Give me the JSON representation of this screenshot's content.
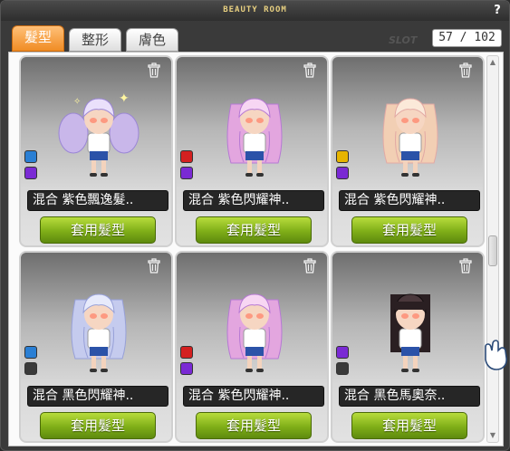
{
  "window": {
    "title": "BEAUTY ROOM",
    "help": "?"
  },
  "tabs": [
    {
      "label": "髮型",
      "active": true
    },
    {
      "label": "整形",
      "active": false
    },
    {
      "label": "膚色",
      "active": false
    }
  ],
  "slot": {
    "label": "SLOT",
    "value": "57 / 102"
  },
  "cards": [
    {
      "name": "混合  紫色飄逸髮..",
      "button": "套用髮型",
      "swatches": [
        "#2a7fd4",
        "#7a2ad4"
      ],
      "hair": "lavender-twintails",
      "icon": "trash-icon"
    },
    {
      "name": "混合  紫色閃耀神..",
      "button": "套用髮型",
      "swatches": [
        "#d42020",
        "#7a2ad4"
      ],
      "hair": "pink-long",
      "icon": "trash-icon"
    },
    {
      "name": "混合  紫色閃耀神..",
      "button": "套用髮型",
      "swatches": [
        "#e6b400",
        "#7a2ad4"
      ],
      "hair": "blonde-long",
      "icon": "trash-icon"
    },
    {
      "name": "混合  黑色閃耀神..",
      "button": "套用髮型",
      "swatches": [
        "#2a7fd4",
        "#3a3a3a"
      ],
      "hair": "silver-long",
      "icon": "trash-icon"
    },
    {
      "name": "混合  紫色閃耀神..",
      "button": "套用髮型",
      "swatches": [
        "#d42020",
        "#7a2ad4"
      ],
      "hair": "pink-long",
      "icon": "trash-icon"
    },
    {
      "name": "混合  黑色馬奧奈..",
      "button": "套用髮型",
      "swatches": [
        "#7a2ad4",
        "#3a3a3a"
      ],
      "hair": "black-straight",
      "icon": "trash-icon"
    }
  ],
  "scrollbar": {
    "position": 0.48
  }
}
